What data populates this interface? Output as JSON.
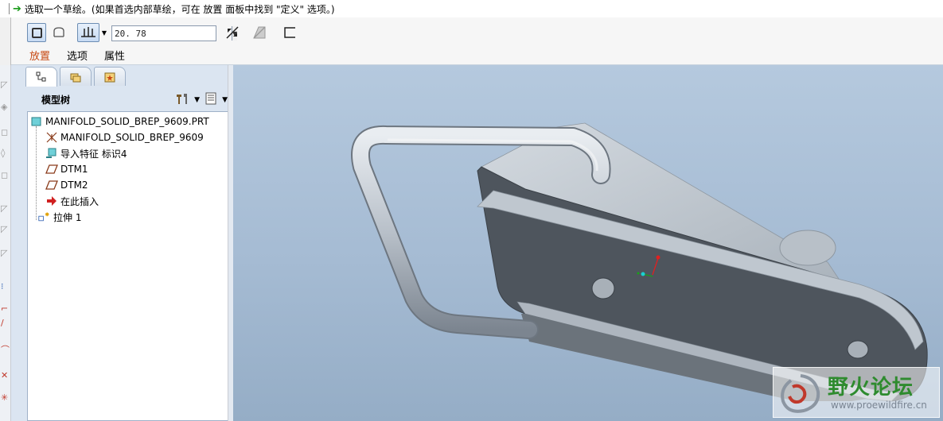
{
  "message_bar": {
    "prompt": "选取一个草绘。(如果首选内部草绘，可在 放置 面板中找到 \"定义\" 选项。)"
  },
  "dashboard": {
    "depth_value": "20. 78",
    "tabs": [
      "放置",
      "选项",
      "属性"
    ],
    "active_tab_color": "#c84a14"
  },
  "model_tree": {
    "header": "模型树",
    "items": [
      {
        "label": "MANIFOLD_SOLID_BREP_9609.PRT",
        "icon": "part-icon"
      },
      {
        "label": "MANIFOLD_SOLID_BREP_9609",
        "icon": "csys-icon"
      },
      {
        "label": "导入特征 标识4",
        "icon": "import-feature-icon"
      },
      {
        "label": "DTM1",
        "icon": "datum-plane-icon"
      },
      {
        "label": "DTM2",
        "icon": "datum-plane-icon"
      },
      {
        "label": "在此插入",
        "icon": "insert-here-arrow-icon"
      },
      {
        "label": "拉伸 1",
        "icon": "extrude-icon"
      }
    ]
  },
  "watermark": {
    "name": "野火论坛",
    "url": "www.proewildfire.cn"
  },
  "colors": {
    "viewport_bg": "#a5bbd3",
    "panel_bg": "#dbe5f1",
    "model_dark": "#505760",
    "model_light": "#c5ccd4"
  }
}
